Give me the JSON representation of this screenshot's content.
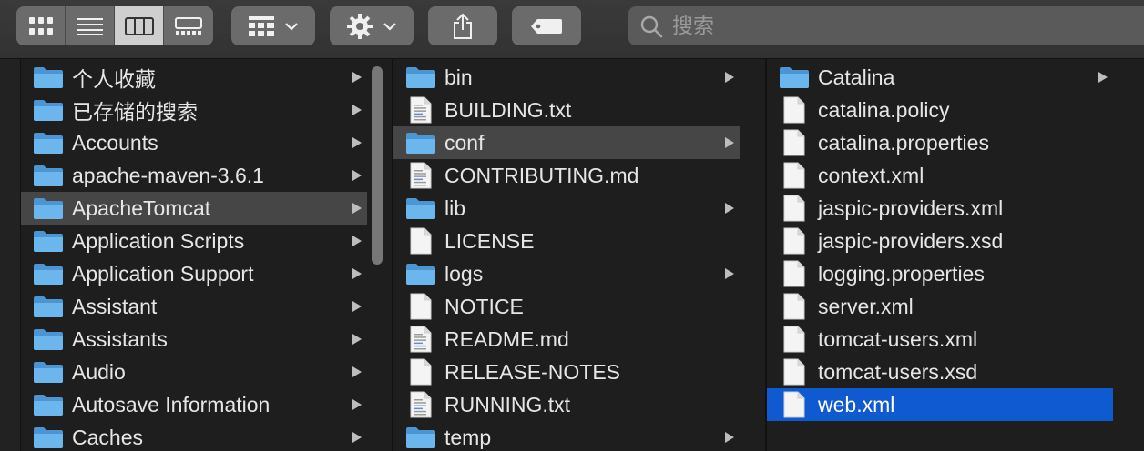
{
  "toolbar": {
    "view_buttons": [
      "icon-view-icon",
      "list-view-icon",
      "column-view-icon",
      "gallery-view-icon"
    ],
    "group_icon": "group-grid-icon",
    "action_icon": "gear-icon",
    "share_icon": "share-icon",
    "tag_icon": "tag-icon",
    "search_placeholder": "搜索"
  },
  "column1": {
    "items": [
      {
        "name": "个人收藏",
        "type": "folder",
        "arrow": true
      },
      {
        "name": "已存储的搜索",
        "type": "folder",
        "arrow": true
      },
      {
        "name": "Accounts",
        "type": "folder",
        "arrow": true
      },
      {
        "name": "apache-maven-3.6.1",
        "type": "folder",
        "arrow": true
      },
      {
        "name": "ApacheTomcat",
        "type": "folder",
        "arrow": true,
        "selected": "gray"
      },
      {
        "name": "Application Scripts",
        "type": "folder",
        "arrow": true
      },
      {
        "name": "Application Support",
        "type": "folder",
        "arrow": true
      },
      {
        "name": "Assistant",
        "type": "folder",
        "arrow": true
      },
      {
        "name": "Assistants",
        "type": "folder",
        "arrow": true
      },
      {
        "name": "Audio",
        "type": "folder",
        "arrow": true
      },
      {
        "name": "Autosave Information",
        "type": "folder",
        "arrow": true
      },
      {
        "name": "Caches",
        "type": "folder",
        "arrow": true
      }
    ]
  },
  "column2": {
    "items": [
      {
        "name": "bin",
        "type": "folder",
        "arrow": true
      },
      {
        "name": "BUILDING.txt",
        "type": "text",
        "arrow": false
      },
      {
        "name": "conf",
        "type": "folder",
        "arrow": true,
        "selected": "gray"
      },
      {
        "name": "CONTRIBUTING.md",
        "type": "text",
        "arrow": false
      },
      {
        "name": "lib",
        "type": "folder",
        "arrow": true
      },
      {
        "name": "LICENSE",
        "type": "file",
        "arrow": false
      },
      {
        "name": "logs",
        "type": "folder",
        "arrow": true
      },
      {
        "name": "NOTICE",
        "type": "file",
        "arrow": false
      },
      {
        "name": "README.md",
        "type": "text",
        "arrow": false
      },
      {
        "name": "RELEASE-NOTES",
        "type": "file",
        "arrow": false
      },
      {
        "name": "RUNNING.txt",
        "type": "text",
        "arrow": false
      },
      {
        "name": "temp",
        "type": "folder",
        "arrow": true
      }
    ]
  },
  "column3": {
    "items": [
      {
        "name": "Catalina",
        "type": "folder",
        "arrow": true
      },
      {
        "name": "catalina.policy",
        "type": "file",
        "arrow": false
      },
      {
        "name": "catalina.properties",
        "type": "file",
        "arrow": false
      },
      {
        "name": "context.xml",
        "type": "file",
        "arrow": false
      },
      {
        "name": "jaspic-providers.xml",
        "type": "file",
        "arrow": false
      },
      {
        "name": "jaspic-providers.xsd",
        "type": "file",
        "arrow": false
      },
      {
        "name": "logging.properties",
        "type": "file",
        "arrow": false
      },
      {
        "name": "server.xml",
        "type": "file",
        "arrow": false
      },
      {
        "name": "tomcat-users.xml",
        "type": "file",
        "arrow": false
      },
      {
        "name": "tomcat-users.xsd",
        "type": "file",
        "arrow": false
      },
      {
        "name": "web.xml",
        "type": "file",
        "arrow": false,
        "selected": "blue"
      }
    ]
  },
  "colors": {
    "selection_blue": "#0f5ad0",
    "selection_gray": "#464646",
    "folder_blue": "#5aa9e6"
  }
}
